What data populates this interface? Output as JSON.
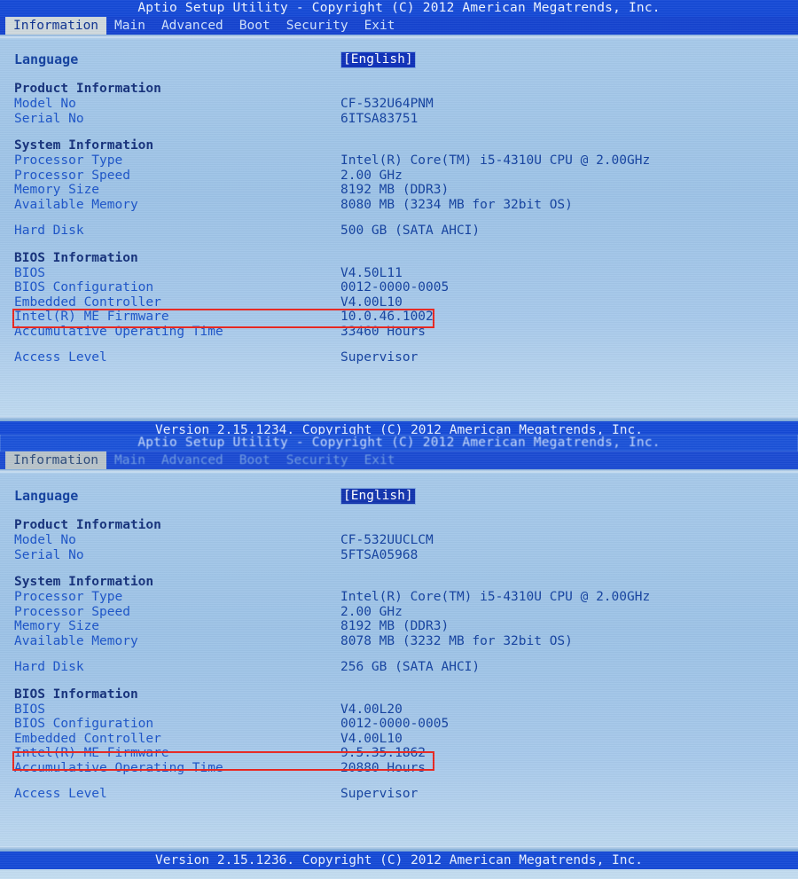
{
  "panels": [
    {
      "title": "Aptio Setup Utility - Copyright (C) 2012 American Megatrends, Inc.",
      "tabs": [
        {
          "label": "Information"
        },
        {
          "label": "Main"
        },
        {
          "label": "Advanced"
        },
        {
          "label": "Boot"
        },
        {
          "label": "Security"
        },
        {
          "label": "Exit"
        }
      ],
      "language": {
        "label": "Language",
        "value": "[English]"
      },
      "product_section": "Product Information",
      "product": [
        {
          "label": "Model No",
          "value": "CF-532U64PNM"
        },
        {
          "label": "Serial No",
          "value": "6ITSA83751"
        }
      ],
      "system_section": "System Information",
      "system": [
        {
          "label": "Processor Type",
          "value": "Intel(R) Core(TM) i5-4310U CPU @ 2.00GHz"
        },
        {
          "label": "Processor Speed",
          "value": "2.00 GHz"
        },
        {
          "label": "Memory Size",
          "value": "8192 MB (DDR3)"
        },
        {
          "label": "Available Memory",
          "value": "8080 MB (3234 MB for 32bit OS)"
        }
      ],
      "hard_disk": {
        "label": "Hard Disk",
        "value": "500 GB (SATA AHCI)"
      },
      "bios_section": "BIOS Information",
      "bios": [
        {
          "label": "BIOS",
          "value": "V4.50L11"
        },
        {
          "label": "BIOS Configuration",
          "value": "0012-0000-0005"
        },
        {
          "label": "Embedded Controller",
          "value": "V4.00L10"
        },
        {
          "label": "Intel(R) ME Firmware",
          "value": "10.0.46.1002"
        },
        {
          "label": "Accumulative Operating Time",
          "value": "33460 Hours"
        }
      ],
      "access_level": {
        "label": "Access Level",
        "value": "Supervisor"
      },
      "version": "Version 2.15.1234. Copyright (C) 2012 American Megatrends, Inc."
    },
    {
      "title": "Aptio Setup Utility - Copyright (C) 2012 American Megatrends, Inc.",
      "tabs": [
        {
          "label": "Information"
        },
        {
          "label": "Main"
        },
        {
          "label": "Advanced"
        },
        {
          "label": "Boot"
        },
        {
          "label": "Security"
        },
        {
          "label": "Exit"
        }
      ],
      "language": {
        "label": "Language",
        "value": "[English]"
      },
      "product_section": "Product Information",
      "product": [
        {
          "label": "Model No",
          "value": "CF-532UUCLCM"
        },
        {
          "label": "Serial No",
          "value": "5FTSA05968"
        }
      ],
      "system_section": "System Information",
      "system": [
        {
          "label": "Processor Type",
          "value": "Intel(R) Core(TM) i5-4310U CPU @ 2.00GHz"
        },
        {
          "label": "Processor Speed",
          "value": "2.00 GHz"
        },
        {
          "label": "Memory Size",
          "value": "8192 MB (DDR3)"
        },
        {
          "label": "Available Memory",
          "value": "8078 MB (3232 MB for 32bit OS)"
        }
      ],
      "hard_disk": {
        "label": "Hard Disk",
        "value": "256 GB (SATA AHCI)"
      },
      "bios_section": "BIOS Information",
      "bios": [
        {
          "label": "BIOS",
          "value": "V4.00L20"
        },
        {
          "label": "BIOS Configuration",
          "value": "0012-0000-0005"
        },
        {
          "label": "Embedded Controller",
          "value": "V4.00L10"
        },
        {
          "label": "Intel(R) ME Firmware",
          "value": "9.5.35.1862"
        },
        {
          "label": "Accumulative Operating Time",
          "value": "20880 Hours"
        }
      ],
      "access_level": {
        "label": "Access Level",
        "value": "Supervisor"
      },
      "version": "Version 2.15.1236. Copyright (C) 2012 American Megatrends, Inc."
    }
  ],
  "annotation": {
    "color": "#e8251f",
    "highlighted_field": "Accumulative Operating Time"
  }
}
